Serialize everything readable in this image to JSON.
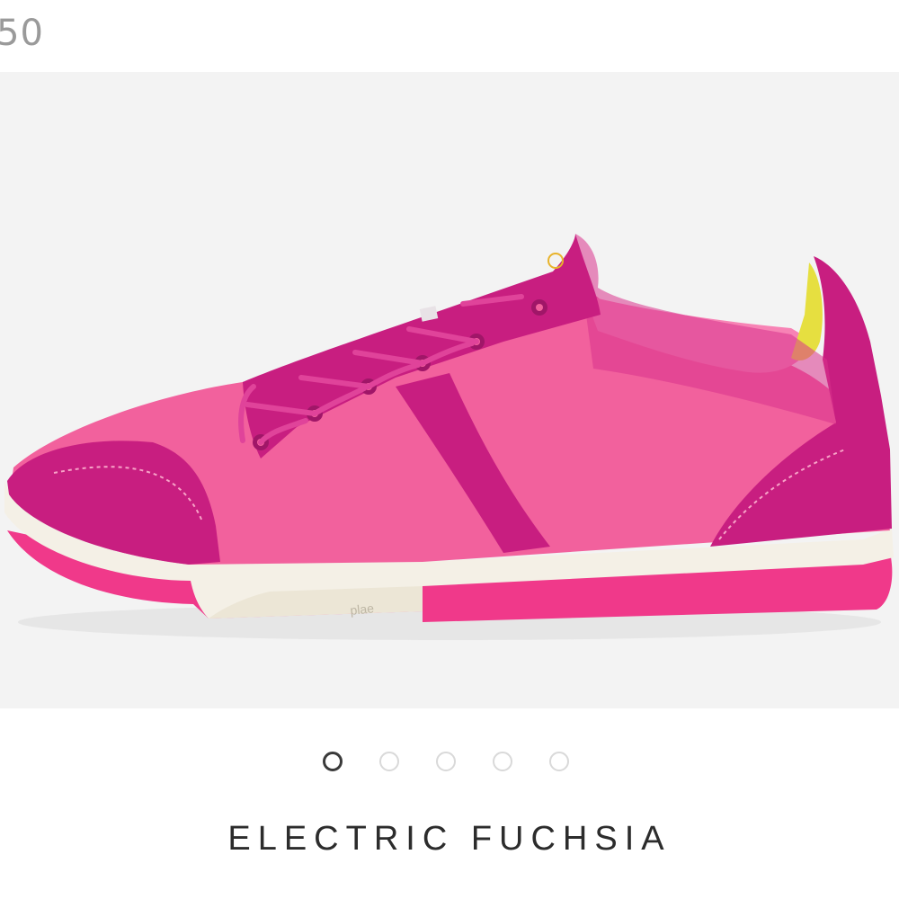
{
  "price_fragment": "50",
  "product_image": {
    "alt": "Pink sneaker side view",
    "sole_text": "plae",
    "colors": {
      "background": "#f3f3f3",
      "upper_light": "#f2619d",
      "upper_dark": "#c81e80",
      "sole_pink": "#f0398a",
      "midsole": "#f4f0e6",
      "heel_yellow": "#e6df40"
    }
  },
  "carousel": {
    "dots": [
      "slide-1",
      "slide-2",
      "slide-3",
      "slide-4",
      "slide-5"
    ],
    "active_index": 0
  },
  "color_name": "ELECTRIC FUCHSIA"
}
